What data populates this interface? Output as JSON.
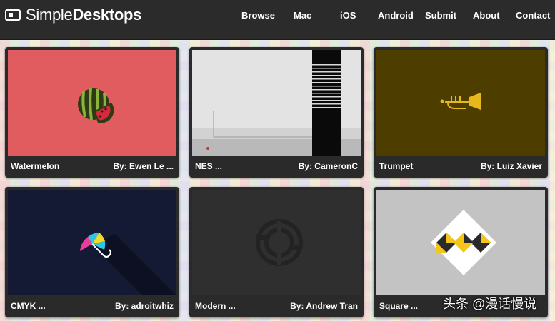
{
  "site": {
    "logo_light": "Simple",
    "logo_bold": "Desktops"
  },
  "nav": [
    "Browse",
    "Mac",
    "iOS",
    "Android",
    "Submit",
    "About",
    "Contact"
  ],
  "cards": [
    {
      "title": "Watermelon",
      "author": "By: Ewen Le ..."
    },
    {
      "title": "NES ...",
      "author": "By: CameronC"
    },
    {
      "title": "Trumpet",
      "author": "By: Luiz Xavier"
    },
    {
      "title": "CMYK ...",
      "author": "By: adroitwhiz"
    },
    {
      "title": "Modern ...",
      "author": "By: Andrew Tran"
    },
    {
      "title": "Square ...",
      "author": ""
    }
  ],
  "watermark": "头条 @漫话慢说",
  "colors": {
    "topbar": "#2b2b2b",
    "card": "#2a2a2a",
    "watermelon_bg": "#e15c5e",
    "trumpet_bg": "#4d3e00",
    "cmyk_bg": "#141a33",
    "modern_bg": "#2f2f2f",
    "square_bg": "#c3c3c3"
  }
}
